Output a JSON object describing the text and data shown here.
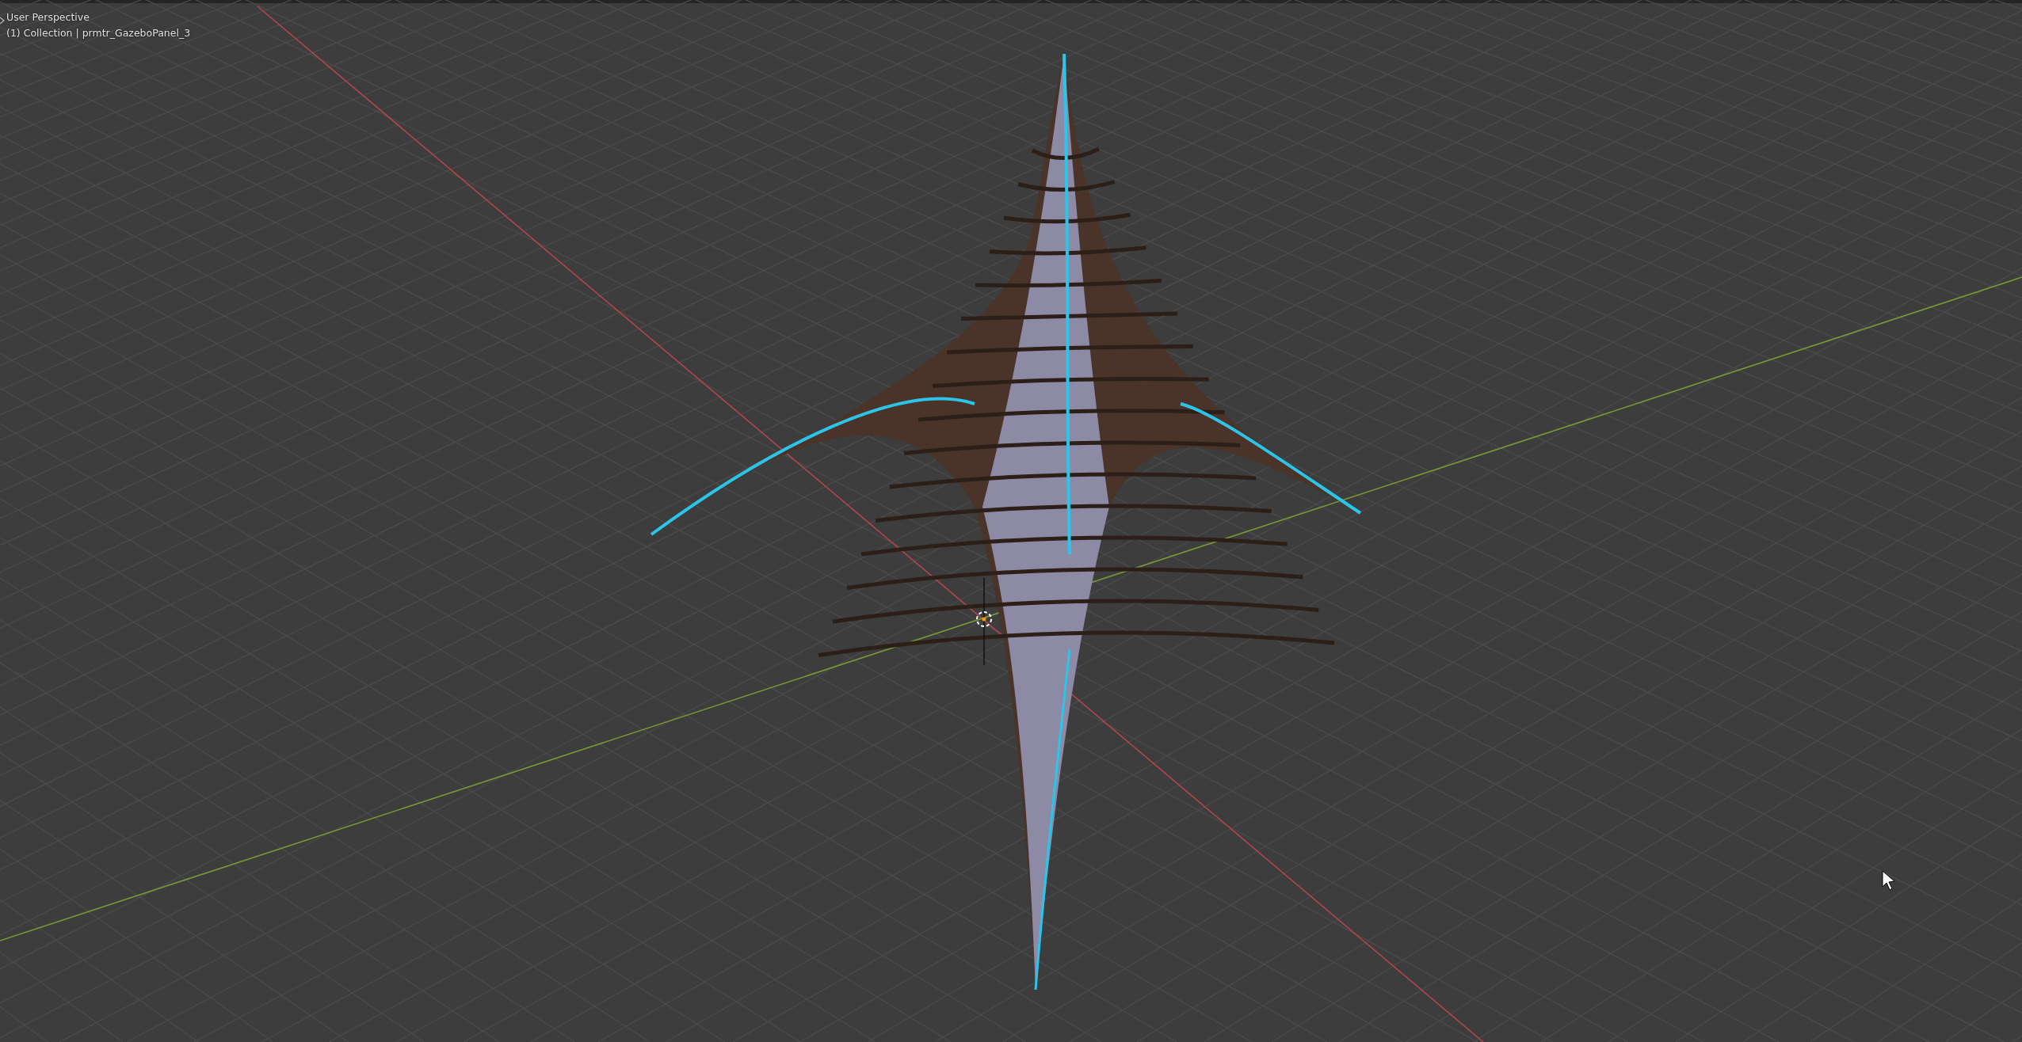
{
  "viewport": {
    "view_name": "User Perspective",
    "object_info": "(1) Collection | prmtr_GazeboPanel_3"
  }
}
